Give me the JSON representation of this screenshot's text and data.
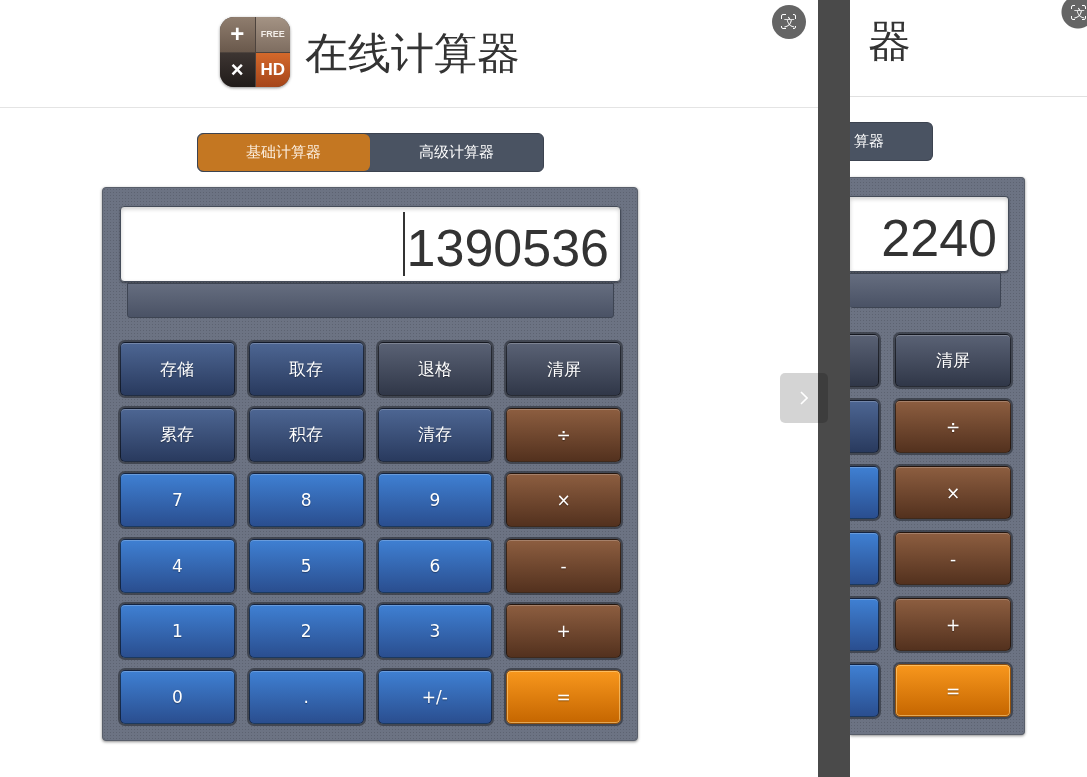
{
  "panels": [
    {
      "kind": "full",
      "header": {
        "logo": {
          "marks": [
            "+",
            "FREE",
            "×",
            "HD"
          ]
        },
        "title": "在线计算器",
        "translate_button": {
          "glyph": "文"
        }
      },
      "mode_tabs": [
        {
          "label": "基础计算器",
          "selected": true
        },
        {
          "label": "高级计算器",
          "selected": false
        }
      ],
      "calculator": {
        "display": {
          "value": "1390536",
          "focused": true
        },
        "keys": [
          {
            "label": "存储",
            "kind": "memory"
          },
          {
            "label": "取存",
            "kind": "memory"
          },
          {
            "label": "退格",
            "kind": "control"
          },
          {
            "label": "清屏",
            "kind": "control"
          },
          {
            "label": "累存",
            "kind": "memory"
          },
          {
            "label": "积存",
            "kind": "memory"
          },
          {
            "label": "清存",
            "kind": "memory"
          },
          {
            "label": "÷",
            "kind": "operator"
          },
          {
            "label": "7",
            "kind": "digit"
          },
          {
            "label": "8",
            "kind": "digit"
          },
          {
            "label": "9",
            "kind": "digit"
          },
          {
            "label": "×",
            "kind": "operator"
          },
          {
            "label": "4",
            "kind": "digit"
          },
          {
            "label": "5",
            "kind": "digit"
          },
          {
            "label": "6",
            "kind": "digit"
          },
          {
            "label": "-",
            "kind": "operator"
          },
          {
            "label": "1",
            "kind": "digit"
          },
          {
            "label": "2",
            "kind": "digit"
          },
          {
            "label": "3",
            "kind": "digit"
          },
          {
            "label": "+",
            "kind": "operator"
          },
          {
            "label": "0",
            "kind": "digit"
          },
          {
            "label": ".",
            "kind": "digit"
          },
          {
            "label": "+/-",
            "kind": "digit"
          },
          {
            "label": "=",
            "kind": "equals"
          }
        ]
      }
    },
    {
      "kind": "cropped",
      "header": {
        "title": "器",
        "translate_button": {
          "glyph": "文"
        }
      },
      "mode_tabs": [
        {
          "label": "算器",
          "selected": false
        }
      ],
      "calculator": {
        "display": {
          "value": "2240",
          "focused": false
        },
        "keys": [
          {
            "kind": "control"
          },
          {
            "label": "清屏",
            "kind": "control"
          },
          {
            "kind": "memory"
          },
          {
            "label": "÷",
            "kind": "operator"
          },
          {
            "kind": "digit"
          },
          {
            "label": "×",
            "kind": "operator"
          },
          {
            "kind": "digit"
          },
          {
            "label": "-",
            "kind": "operator"
          },
          {
            "kind": "digit"
          },
          {
            "label": "+",
            "kind": "operator"
          },
          {
            "kind": "digit"
          },
          {
            "label": "=",
            "kind": "equals"
          }
        ]
      }
    }
  ]
}
